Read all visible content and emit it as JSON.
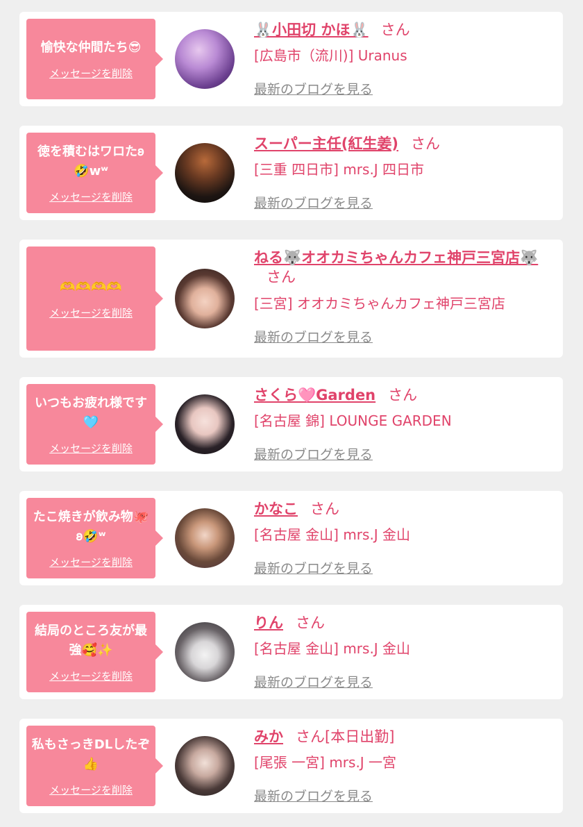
{
  "items": [
    {
      "message": "愉快な仲間たち😎",
      "delete_label": "メッセージを削除",
      "name": "🐰小田切 かほ🐰",
      "san": "さん",
      "shop": "[広島市（流川)] Uranus",
      "blog_link": "最新のブログを見る"
    },
    {
      "message": "徳を積むはワロた𐐪🤣wʷ",
      "delete_label": "メッセージを削除",
      "name": "スーパー主任(紅生姜)",
      "san": "さん",
      "shop": "[三重 四日市] mrs.J 四日市",
      "blog_link": "最新のブログを見る"
    },
    {
      "message": "🫶🫶🫶🫶",
      "delete_label": "メッセージを削除",
      "name": "ねる🐺オオカミちゃんカフェ神戸三宮店🐺",
      "san": "さん",
      "shop": "[三宮] オオカミちゃんカフェ神戸三宮店",
      "blog_link": "最新のブログを見る"
    },
    {
      "message": "いつもお疲れ様です🩵",
      "delete_label": "メッセージを削除",
      "name": "さくら🩷Garden",
      "san": "さん",
      "shop": "[名古屋 錦] LOUNGE GARDEN",
      "blog_link": "最新のブログを見る"
    },
    {
      "message": "たこ焼きが飲み物🐙𐐪🤣ʷ",
      "delete_label": "メッセージを削除",
      "name": "かなこ",
      "san": "さん",
      "shop": "[名古屋 金山] mrs.J 金山",
      "blog_link": "最新のブログを見る"
    },
    {
      "message": "結局のところ友が最強🥰✨",
      "delete_label": "メッセージを削除",
      "name": "りん",
      "san": "さん",
      "shop": "[名古屋 金山] mrs.J 金山",
      "blog_link": "最新のブログを見る"
    },
    {
      "message": "私もさっきDLしたぞ👍",
      "delete_label": "メッセージを削除",
      "name": "みか",
      "san": "さん[本日出勤]",
      "shop": "[尾張 一宮] mrs.J 一宮",
      "blog_link": "最新のブログを見る"
    }
  ]
}
